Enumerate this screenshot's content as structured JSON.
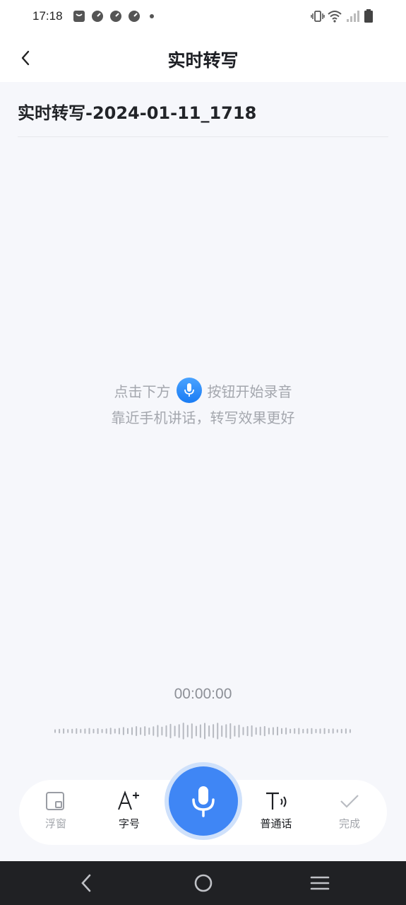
{
  "status_bar": {
    "time": "17:18",
    "notification_icons": [
      "bag-icon",
      "gauge-icon",
      "gauge-icon",
      "gauge-icon",
      "dot-icon"
    ],
    "right_icons": [
      "vibrate-icon",
      "wifi-icon",
      "signal-icon",
      "battery-icon"
    ]
  },
  "header": {
    "title": "实时转写",
    "back_icon": "chevron-left-icon"
  },
  "document": {
    "title": "实时转写-2024-01-11_1718"
  },
  "hint": {
    "line1_before": "点击下方",
    "line1_after": "按钮开始录音",
    "line2": "靠近手机讲话，转写效果更好"
  },
  "recording": {
    "timer": "00:00:00"
  },
  "toolbar": {
    "items": [
      {
        "label": "浮窗",
        "icon": "floating-window-icon"
      },
      {
        "label": "字号",
        "icon": "font-size-icon"
      },
      {
        "label": "普通话",
        "icon": "language-icon"
      },
      {
        "label": "完成",
        "icon": "check-icon"
      }
    ]
  },
  "colors": {
    "accent": "#3f86f5",
    "accent_ring": "#cfe1fb",
    "background": "#f6f7fb",
    "nav_bar": "#202124"
  }
}
